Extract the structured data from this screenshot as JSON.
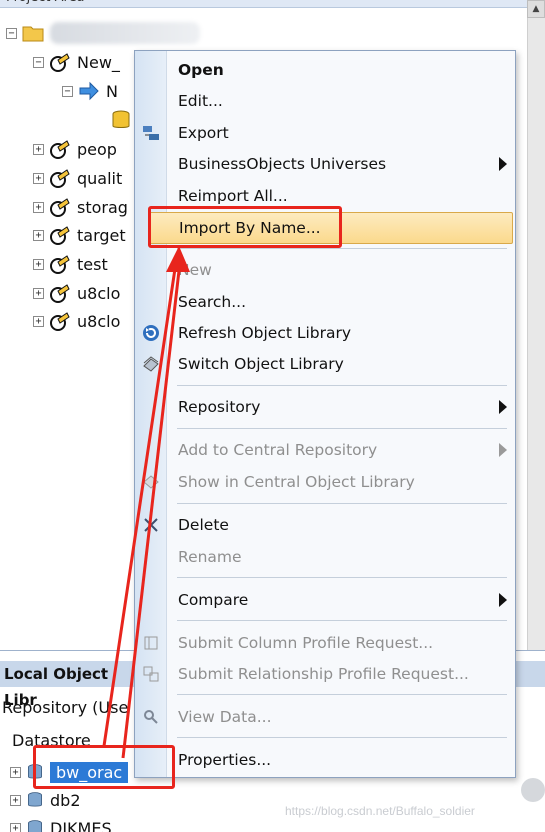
{
  "project_area": {
    "header_title": "Project Area",
    "tree": [
      {
        "id": "root",
        "label": "",
        "expander": "-",
        "icon": "folder-icon",
        "blurred": true
      },
      {
        "id": "new-project",
        "label": "New_",
        "expander": "-",
        "icon": "project-icon"
      },
      {
        "id": "new-job",
        "label": "N",
        "expander": "-",
        "icon": "job-icon"
      },
      {
        "id": "new-datastore",
        "label": "",
        "expander": "",
        "icon": "database-icon"
      },
      {
        "id": "people",
        "label": "peop",
        "expander": "+",
        "icon": "project-icon"
      },
      {
        "id": "quality",
        "label": "qualit",
        "expander": "+",
        "icon": "project-icon"
      },
      {
        "id": "storage",
        "label": "storag",
        "expander": "+",
        "icon": "project-icon"
      },
      {
        "id": "target",
        "label": "target",
        "expander": "+",
        "icon": "project-icon"
      },
      {
        "id": "test",
        "label": "test",
        "expander": "+",
        "icon": "project-icon"
      },
      {
        "id": "u8cloud-1",
        "label": "u8clo",
        "expander": "+",
        "icon": "project-icon"
      },
      {
        "id": "u8cloud-2",
        "label": "u8clo",
        "expander": "+",
        "icon": "project-icon"
      }
    ]
  },
  "local_library": {
    "title": "Local Object Libr",
    "repository_label": "Repository (Use",
    "column_header": "Datastore",
    "items": [
      {
        "label": "bw_orac",
        "selected": true,
        "expander": "+"
      },
      {
        "label": "db2",
        "selected": false,
        "expander": "+"
      },
      {
        "label": "DJKMES",
        "selected": false,
        "expander": "+"
      }
    ]
  },
  "context_menu": {
    "items": [
      {
        "key": "open",
        "label": "Open",
        "enabled": true,
        "bold": true
      },
      {
        "key": "edit",
        "label": "Edit...",
        "enabled": true
      },
      {
        "key": "export",
        "label": "Export",
        "enabled": true,
        "icon": "export-icon"
      },
      {
        "key": "bo_universes",
        "label": "BusinessObjects Universes",
        "enabled": true,
        "submenu": true
      },
      {
        "key": "reimport_all",
        "label": "Reimport All...",
        "enabled": true
      },
      {
        "key": "import_by_name",
        "label": "Import By Name...",
        "enabled": true,
        "highlighted": true
      },
      {
        "key": "new",
        "label": "New",
        "enabled": false
      },
      {
        "key": "search",
        "label": "Search...",
        "enabled": true
      },
      {
        "key": "refresh",
        "label": "Refresh Object Library",
        "enabled": true,
        "icon": "refresh-icon"
      },
      {
        "key": "switch",
        "label": "Switch Object Library",
        "enabled": true,
        "icon": "switch-library-icon"
      },
      {
        "key": "repository",
        "label": "Repository",
        "enabled": true,
        "submenu": true
      },
      {
        "key": "add_central",
        "label": "Add to Central Repository",
        "enabled": false,
        "submenu": true
      },
      {
        "key": "show_central",
        "label": "Show in Central Object Library",
        "enabled": false,
        "icon": "central-library-icon"
      },
      {
        "key": "delete",
        "label": "Delete",
        "enabled": true,
        "icon": "delete-x-icon"
      },
      {
        "key": "rename",
        "label": "Rename",
        "enabled": false
      },
      {
        "key": "compare",
        "label": "Compare",
        "enabled": true,
        "submenu": true
      },
      {
        "key": "submit_column",
        "label": "Submit Column Profile Request...",
        "enabled": false,
        "icon": "column-profile-icon"
      },
      {
        "key": "submit_relationship",
        "label": "Submit Relationship Profile Request...",
        "enabled": false,
        "icon": "relationship-profile-icon"
      },
      {
        "key": "view_data",
        "label": "View Data...",
        "enabled": false,
        "icon": "magnifier-icon"
      },
      {
        "key": "properties",
        "label": "Properties...",
        "enabled": true
      }
    ]
  },
  "watermark": "https://blog.csdn.net/Buffalo_soldier",
  "colors": {
    "annotation_red": "#e8251d",
    "selection_blue": "#2c7ad6",
    "menu_highlight": "#fbd98c",
    "menu_gutter": "#d5e3f3",
    "disabled_text": "#8f8f8f"
  }
}
